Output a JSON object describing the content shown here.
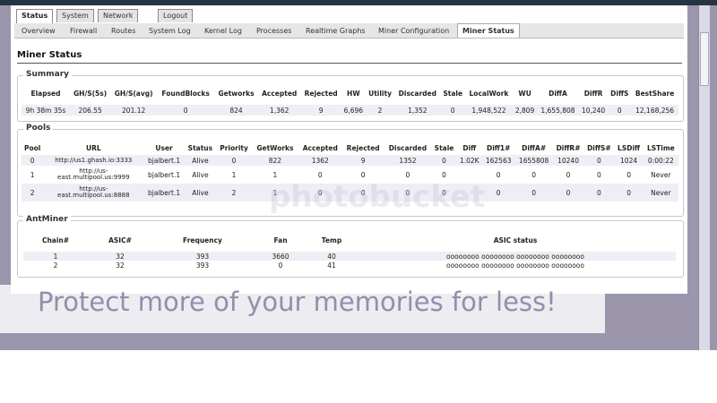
{
  "main_tabs": [
    "Status",
    "System",
    "Network",
    "Logout"
  ],
  "sub_tabs": [
    "Overview",
    "Firewall",
    "Routes",
    "System Log",
    "Kernel Log",
    "Processes",
    "Realtime Graphs",
    "Miner Configuration",
    "Miner Status"
  ],
  "page_title": "Miner Status",
  "summary": {
    "legend": "Summary",
    "headers": [
      "Elapsed",
      "GH/S(5s)",
      "GH/S(avg)",
      "FoundBlocks",
      "Getworks",
      "Accepted",
      "Rejected",
      "HW",
      "Utility",
      "Discarded",
      "Stale",
      "LocalWork",
      "WU",
      "DiffA",
      "DiffR",
      "DiffS",
      "BestShare"
    ],
    "rows": [
      [
        "9h 38m 35s",
        "206.55",
        "201.12",
        "0",
        "824",
        "1,362",
        "9",
        "6,696",
        "2",
        "1,352",
        "0",
        "1,948,522",
        "2,809",
        "1,655,808",
        "10,240",
        "0",
        "12,168,256"
      ]
    ]
  },
  "pools": {
    "legend": "Pools",
    "headers": [
      "Pool",
      "URL",
      "User",
      "Status",
      "Priority",
      "GetWorks",
      "Accepted",
      "Rejected",
      "Discarded",
      "Stale",
      "Diff",
      "Diff1#",
      "DiffA#",
      "DiffR#",
      "DiffS#",
      "LSDiff",
      "LSTime"
    ],
    "rows": [
      [
        "0",
        "http://us1.ghash.io:3333",
        "bjalbert.1",
        "Alive",
        "0",
        "822",
        "1362",
        "9",
        "1352",
        "0",
        "1.02K",
        "162563",
        "1655808",
        "10240",
        "0",
        "1024",
        "0:00:22"
      ],
      [
        "1",
        "http://us-east.multipool.us:9999",
        "bjalbert.1",
        "Alive",
        "1",
        "1",
        "0",
        "0",
        "0",
        "0",
        "",
        "0",
        "0",
        "0",
        "0",
        "0",
        "Never"
      ],
      [
        "2",
        "http://us-east.multipool.us:8888",
        "bjalbert.1",
        "Alive",
        "2",
        "1",
        "0",
        "0",
        "0",
        "0",
        "",
        "0",
        "0",
        "0",
        "0",
        "0",
        "Never"
      ]
    ]
  },
  "antminer": {
    "legend": "AntMiner",
    "headers": [
      "Chain#",
      "ASIC#",
      "Frequency",
      "Fan",
      "Temp",
      "ASIC status"
    ],
    "rows": [
      [
        "1",
        "32",
        "393",
        "3660",
        "40",
        "oooooooo oooooooo oooooooo oooooooo"
      ],
      [
        "2",
        "32",
        "393",
        "0",
        "41",
        "oooooooo oooooooo oooooooo oooooooo"
      ]
    ]
  },
  "watermark": {
    "logo": "photobucket",
    "tagline": "Protect more of your memories for less!"
  }
}
